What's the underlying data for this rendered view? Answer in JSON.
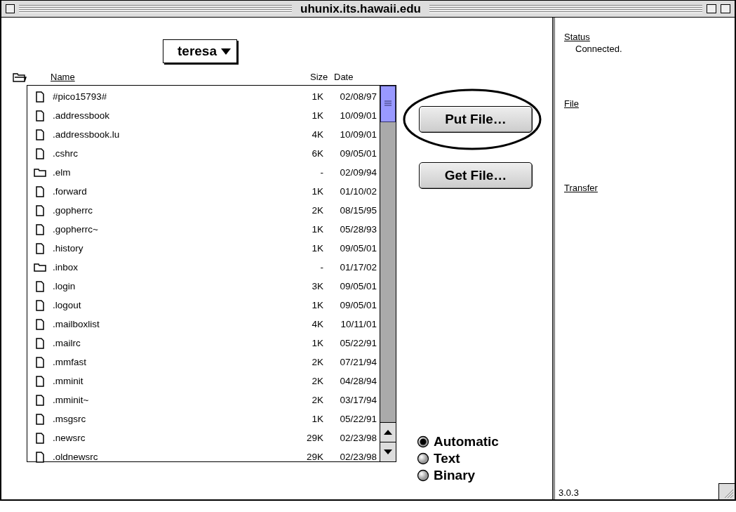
{
  "window": {
    "title": "uhunix.its.hawaii.edu"
  },
  "folder_menu": {
    "label": "teresa"
  },
  "columns": [
    "Name",
    "Size",
    "Date"
  ],
  "files": [
    {
      "kind": "file",
      "name": "#pico15793#",
      "size": "1K",
      "date": "02/08/97"
    },
    {
      "kind": "file",
      "name": ".addressbook",
      "size": "1K",
      "date": "10/09/01"
    },
    {
      "kind": "file",
      "name": ".addressbook.lu",
      "size": "4K",
      "date": "10/09/01"
    },
    {
      "kind": "file",
      "name": ".cshrc",
      "size": "6K",
      "date": "09/05/01"
    },
    {
      "kind": "folder",
      "name": ".elm",
      "size": "-",
      "date": "02/09/94"
    },
    {
      "kind": "file",
      "name": ".forward",
      "size": "1K",
      "date": "01/10/02"
    },
    {
      "kind": "file",
      "name": ".gopherrc",
      "size": "2K",
      "date": "08/15/95"
    },
    {
      "kind": "file",
      "name": ".gopherrc~",
      "size": "1K",
      "date": "05/28/93"
    },
    {
      "kind": "file",
      "name": ".history",
      "size": "1K",
      "date": "09/05/01"
    },
    {
      "kind": "folder",
      "name": ".inbox",
      "size": "-",
      "date": "01/17/02"
    },
    {
      "kind": "file",
      "name": ".login",
      "size": "3K",
      "date": "09/05/01"
    },
    {
      "kind": "file",
      "name": ".logout",
      "size": "1K",
      "date": "09/05/01"
    },
    {
      "kind": "file",
      "name": ".mailboxlist",
      "size": "4K",
      "date": "10/11/01"
    },
    {
      "kind": "file",
      "name": ".mailrc",
      "size": "1K",
      "date": "05/22/91"
    },
    {
      "kind": "file",
      "name": ".mmfast",
      "size": "2K",
      "date": "07/21/94"
    },
    {
      "kind": "file",
      "name": ".mminit",
      "size": "2K",
      "date": "04/28/94"
    },
    {
      "kind": "file",
      "name": ".mminit~",
      "size": "2K",
      "date": "03/17/94"
    },
    {
      "kind": "file",
      "name": ".msgsrc",
      "size": "1K",
      "date": "05/22/91"
    },
    {
      "kind": "file",
      "name": ".newsrc",
      "size": "29K",
      "date": "02/23/98"
    },
    {
      "kind": "file",
      "name": ".oldnewsrc",
      "size": "29K",
      "date": "02/23/98"
    }
  ],
  "buttons": [
    {
      "label": "Put File…",
      "circled": true
    },
    {
      "label": "Get File…",
      "circled": false
    }
  ],
  "transfer_modes": [
    {
      "label": "Automatic",
      "selected": true
    },
    {
      "label": "Text",
      "selected": false
    },
    {
      "label": "Binary",
      "selected": false
    }
  ],
  "status_panel": {
    "sections": [
      {
        "heading": "Status",
        "text": "Connected."
      },
      {
        "heading": "File"
      },
      {
        "heading": "Transfer"
      }
    ],
    "version": "3.0.3"
  }
}
